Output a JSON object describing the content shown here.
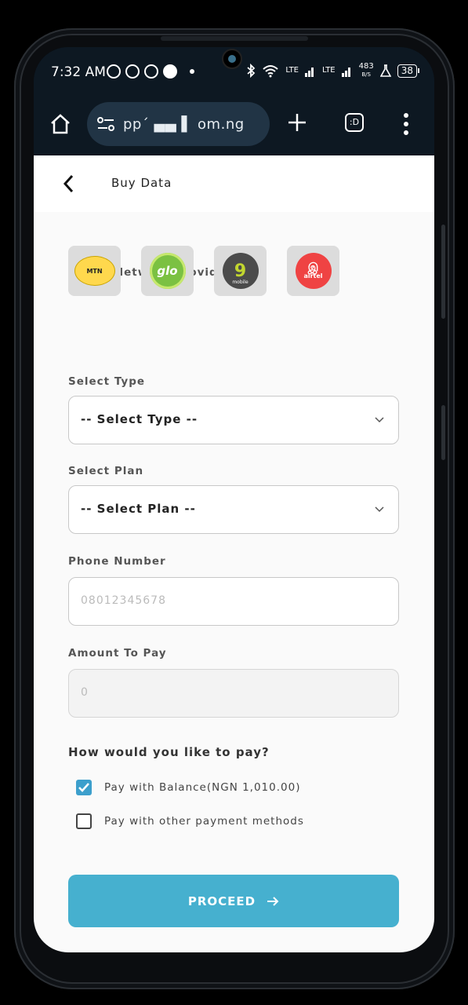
{
  "status_bar": {
    "time": "7:32 AM",
    "network_labels": [
      "LTE",
      "LTE"
    ],
    "speed_value": "483",
    "speed_unit": "B/S",
    "battery": "38"
  },
  "browser": {
    "url": "pp´  ▄▄  ▌  om.ng"
  },
  "app": {
    "title": "Buy Data",
    "network_label": "Select Network Provider",
    "providers": [
      {
        "name": "MTN",
        "color": "#FFD84D"
      },
      {
        "name": "glo",
        "color": "#7BC142"
      },
      {
        "name": "9",
        "sub": "mobile",
        "color": "#4B4B4B"
      },
      {
        "name": "airtel",
        "color": "#EF4343"
      }
    ],
    "type_label": "Select Type",
    "type_value": "-- Select Type --",
    "plan_label": "Select Plan",
    "plan_value": "-- Select Plan --",
    "phone_label": "Phone Number",
    "phone_placeholder": "08012345678",
    "amount_label": "Amount To Pay",
    "amount_value": "0",
    "pay_question": "How would you like to pay?",
    "options": [
      {
        "label": "Pay with Balance(NGN 1,010.00)",
        "checked": true
      },
      {
        "label": "Pay with other payment methods",
        "checked": false
      }
    ],
    "proceed_label": "PROCEED",
    "accent": "#46B0CF"
  }
}
